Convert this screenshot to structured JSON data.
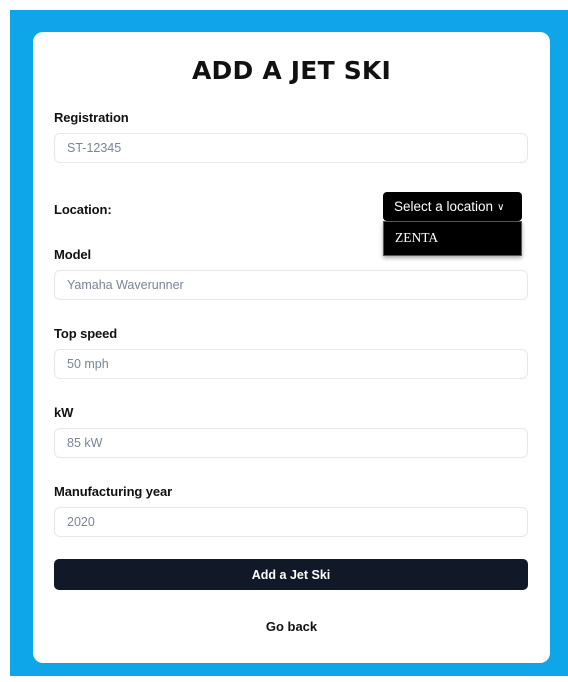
{
  "form": {
    "title": "ADD A JET SKI",
    "registration": {
      "label": "Registration",
      "placeholder": "ST-12345"
    },
    "location": {
      "label": "Location:",
      "select_label": "Select a location",
      "chevron": "chevron-down-icon",
      "options": [
        "ZENTA"
      ]
    },
    "model": {
      "label": "Model",
      "placeholder": "Yamaha Waverunner"
    },
    "top_speed": {
      "label": "Top speed",
      "placeholder": "50 mph"
    },
    "kw": {
      "label": "kW",
      "placeholder": "85 kW"
    },
    "year": {
      "label": "Manufacturing year",
      "placeholder": "2020"
    },
    "submit_label": "Add a Jet Ski",
    "back_label": "Go back"
  },
  "colors": {
    "frame": "#0ea5e9",
    "card": "#ffffff",
    "button": "#111827",
    "select": "#000000"
  }
}
